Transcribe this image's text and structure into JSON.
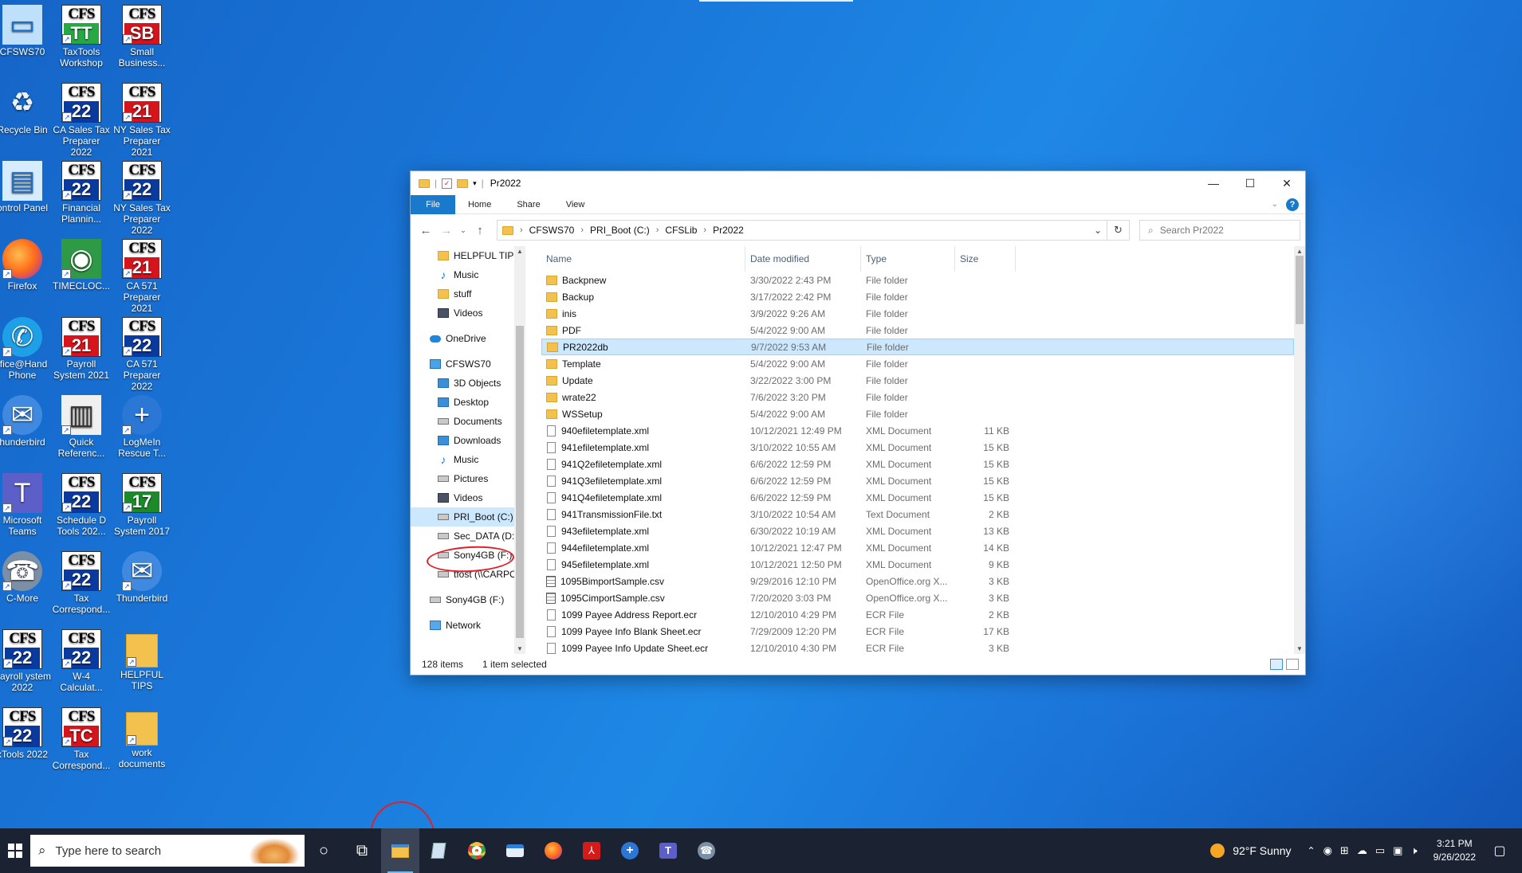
{
  "desktop": {
    "icons": [
      {
        "label": "CFSWS70",
        "kind": "pc"
      },
      {
        "label": "TaxTools Workshop",
        "kind": "cfs",
        "badge": "TT",
        "color": "teal"
      },
      {
        "label": "Small Business...",
        "kind": "cfs",
        "badge": "SB",
        "color": "red"
      },
      {
        "label": "Recycle Bin",
        "kind": "bin"
      },
      {
        "label": "CA Sales Tax Preparer 2022",
        "kind": "cfs",
        "badge": "22",
        "color": "blue"
      },
      {
        "label": "NY Sales Tax Preparer 2021",
        "kind": "cfs",
        "badge": "21",
        "color": "red"
      },
      {
        "label": "ontrol Panel",
        "kind": "control"
      },
      {
        "label": "Financial Plannin...",
        "kind": "cfs",
        "badge": "22",
        "color": "blue"
      },
      {
        "label": "NY Sales Tax Preparer 2022",
        "kind": "cfs",
        "badge": "22",
        "color": "blue"
      },
      {
        "label": "Firefox",
        "kind": "firefox"
      },
      {
        "label": "TIMECLOC...",
        "kind": "eye"
      },
      {
        "label": "CA 571 Preparer 2021",
        "kind": "cfs",
        "badge": "21",
        "color": "red"
      },
      {
        "label": "ffice@Hand Phone",
        "kind": "phone"
      },
      {
        "label": "Payroll System 2021",
        "kind": "cfs",
        "badge": "21",
        "color": "red"
      },
      {
        "label": "CA 571 Preparer 2022",
        "kind": "cfs",
        "badge": "22",
        "color": "blue"
      },
      {
        "label": "hunderbird",
        "kind": "bird"
      },
      {
        "label": "Quick Referenc...",
        "kind": "book"
      },
      {
        "label": "LogMeIn Rescue T...",
        "kind": "rescue"
      },
      {
        "label": "Microsoft Teams",
        "kind": "teams"
      },
      {
        "label": "Schedule D Tools 202...",
        "kind": "cfs",
        "badge": "22",
        "color": "blue"
      },
      {
        "label": "Payroll System 2017",
        "kind": "cfs",
        "badge": "17",
        "color": "green"
      },
      {
        "label": "C-More",
        "kind": "cmore"
      },
      {
        "label": "Tax Correspond...",
        "kind": "cfs",
        "badge": "22",
        "color": "blue"
      },
      {
        "label": "Thunderbird",
        "kind": "bird"
      },
      {
        "label": "Payroll ystem 2022",
        "kind": "cfs",
        "badge": "22",
        "color": "blue"
      },
      {
        "label": "W-4 Calculat...",
        "kind": "cfs",
        "badge": "22",
        "color": "blue"
      },
      {
        "label": "HELPFUL TIPS",
        "kind": "folder"
      },
      {
        "label": "xTools 2022",
        "kind": "cfs",
        "badge": "22",
        "color": "blue"
      },
      {
        "label": "Tax Correspond...",
        "kind": "cfs",
        "badge": "TC",
        "color": "red"
      },
      {
        "label": "work documents",
        "kind": "folder"
      }
    ],
    "cfs_text": "CFS"
  },
  "window": {
    "title": "Pr2022",
    "controls": {
      "minimize": "—",
      "maximize": "☐",
      "close": "✕"
    },
    "ribbon_tabs": [
      "File",
      "Home",
      "Share",
      "View"
    ],
    "help": "?",
    "address": {
      "crumbs": [
        "CFSWS70",
        "PRI_Boot (C:)",
        "CFSLib",
        "Pr2022"
      ]
    },
    "search_placeholder": "Search Pr2022",
    "nav_items": [
      {
        "label": "HELPFUL TIPS",
        "icon": "folder",
        "indent": 1
      },
      {
        "label": "Music",
        "icon": "music",
        "indent": 1
      },
      {
        "label": "stuff",
        "icon": "folder",
        "indent": 1
      },
      {
        "label": "Videos",
        "icon": "dark",
        "indent": 1
      },
      {
        "label": "",
        "icon": "",
        "indent": 0
      },
      {
        "label": "OneDrive",
        "icon": "cloud",
        "indent": 0
      },
      {
        "label": "",
        "icon": "",
        "indent": 0
      },
      {
        "label": "CFSWS70",
        "icon": "pc",
        "indent": 0
      },
      {
        "label": "3D Objects",
        "icon": "blue",
        "indent": 1
      },
      {
        "label": "Desktop",
        "icon": "blue",
        "indent": 1
      },
      {
        "label": "Documents",
        "icon": "drive",
        "indent": 1
      },
      {
        "label": "Downloads",
        "icon": "blue",
        "indent": 1
      },
      {
        "label": "Music",
        "icon": "music",
        "indent": 1
      },
      {
        "label": "Pictures",
        "icon": "drive",
        "indent": 1
      },
      {
        "label": "Videos",
        "icon": "dark",
        "indent": 1
      },
      {
        "label": "PRI_Boot (C:)",
        "icon": "drive",
        "indent": 1,
        "selected": true
      },
      {
        "label": "Sec_DATA (D:)",
        "icon": "drive",
        "indent": 1
      },
      {
        "label": "Sony4GB (F:)",
        "icon": "drive",
        "indent": 1
      },
      {
        "label": "tfost (\\\\CARPO\\",
        "icon": "drive",
        "indent": 1
      },
      {
        "label": "",
        "icon": "",
        "indent": 0
      },
      {
        "label": "Sony4GB (F:)",
        "icon": "drive",
        "indent": 0
      },
      {
        "label": "",
        "icon": "",
        "indent": 0
      },
      {
        "label": "Network",
        "icon": "net",
        "indent": 0
      }
    ],
    "columns": [
      "Name",
      "Date modified",
      "Type",
      "Size"
    ],
    "files": [
      {
        "name": "Backpnew",
        "date": "3/30/2022 2:43 PM",
        "type": "File folder",
        "size": "",
        "icon": "folder"
      },
      {
        "name": "Backup",
        "date": "3/17/2022 2:42 PM",
        "type": "File folder",
        "size": "",
        "icon": "folder"
      },
      {
        "name": "inis",
        "date": "3/9/2022 9:26 AM",
        "type": "File folder",
        "size": "",
        "icon": "folder"
      },
      {
        "name": "PDF",
        "date": "5/4/2022 9:00 AM",
        "type": "File folder",
        "size": "",
        "icon": "folder"
      },
      {
        "name": "PR2022db",
        "date": "9/7/2022 9:53 AM",
        "type": "File folder",
        "size": "",
        "icon": "folder",
        "selected": true
      },
      {
        "name": "Template",
        "date": "5/4/2022 9:00 AM",
        "type": "File folder",
        "size": "",
        "icon": "folder"
      },
      {
        "name": "Update",
        "date": "3/22/2022 3:00 PM",
        "type": "File folder",
        "size": "",
        "icon": "folder"
      },
      {
        "name": "wrate22",
        "date": "7/6/2022 3:20 PM",
        "type": "File folder",
        "size": "",
        "icon": "folder"
      },
      {
        "name": "WSSetup",
        "date": "5/4/2022 9:00 AM",
        "type": "File folder",
        "size": "",
        "icon": "folder"
      },
      {
        "name": "940efiletemplate.xml",
        "date": "10/12/2021 12:49 PM",
        "type": "XML Document",
        "size": "11 KB",
        "icon": "xml"
      },
      {
        "name": "941efiletemplate.xml",
        "date": "3/10/2022 10:55 AM",
        "type": "XML Document",
        "size": "15 KB",
        "icon": "xml"
      },
      {
        "name": "941Q2efiletemplate.xml",
        "date": "6/6/2022 12:59 PM",
        "type": "XML Document",
        "size": "15 KB",
        "icon": "xml"
      },
      {
        "name": "941Q3efiletemplate.xml",
        "date": "6/6/2022 12:59 PM",
        "type": "XML Document",
        "size": "15 KB",
        "icon": "xml"
      },
      {
        "name": "941Q4efiletemplate.xml",
        "date": "6/6/2022 12:59 PM",
        "type": "XML Document",
        "size": "15 KB",
        "icon": "xml"
      },
      {
        "name": "941TransmissionFile.txt",
        "date": "3/10/2022 10:54 AM",
        "type": "Text Document",
        "size": "2 KB",
        "icon": "txt"
      },
      {
        "name": "943efiletemplate.xml",
        "date": "6/30/2022 10:19 AM",
        "type": "XML Document",
        "size": "13 KB",
        "icon": "xml"
      },
      {
        "name": "944efiletemplate.xml",
        "date": "10/12/2021 12:47 PM",
        "type": "XML Document",
        "size": "14 KB",
        "icon": "xml"
      },
      {
        "name": "945efiletemplate.xml",
        "date": "10/12/2021 12:50 PM",
        "type": "XML Document",
        "size": "9 KB",
        "icon": "xml"
      },
      {
        "name": "1095BimportSample.csv",
        "date": "9/29/2016 12:10 PM",
        "type": "OpenOffice.org X...",
        "size": "3 KB",
        "icon": "csv"
      },
      {
        "name": "1095CimportSample.csv",
        "date": "7/20/2020 3:03 PM",
        "type": "OpenOffice.org X...",
        "size": "3 KB",
        "icon": "csv"
      },
      {
        "name": "1099 Payee Address Report.ecr",
        "date": "12/10/2010 4:29 PM",
        "type": "ECR File",
        "size": "2 KB",
        "icon": "ecr"
      },
      {
        "name": "1099 Payee Info Blank Sheet.ecr",
        "date": "7/29/2009 12:20 PM",
        "type": "ECR File",
        "size": "17 KB",
        "icon": "ecr"
      },
      {
        "name": "1099 Payee Info Update Sheet.ecr",
        "date": "12/10/2010 4:30 PM",
        "type": "ECR File",
        "size": "3 KB",
        "icon": "ecr"
      }
    ],
    "status": {
      "count": "128 items",
      "selection": "1 item selected"
    }
  },
  "taskbar": {
    "search_placeholder": "Type here to search",
    "weather": "92°F  Sunny",
    "time": "3:21 PM",
    "date": "9/26/2022"
  }
}
